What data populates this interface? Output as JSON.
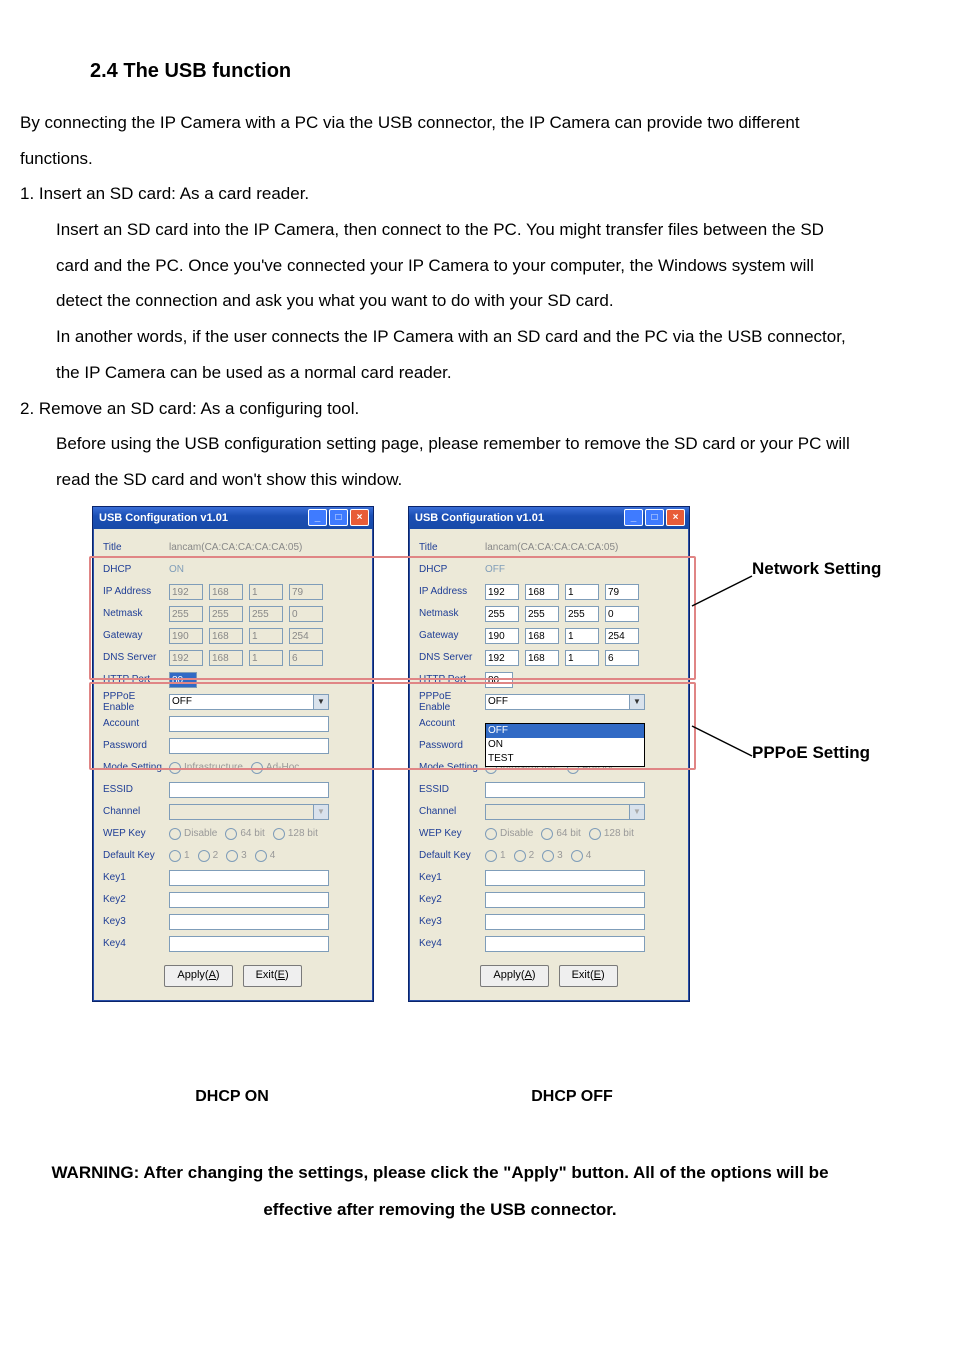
{
  "heading": "2.4 The USB function",
  "intro": "By connecting the IP Camera with a PC via the USB connector, the IP Camera can provide two different functions.",
  "item1": {
    "lead": "1. Insert an SD card: As a card reader.",
    "p1": "Insert an SD card into the IP Camera, then connect to the PC. You might transfer files between the SD card and the PC. Once you've connected your IP Camera to your computer, the Windows system will detect the connection and ask you what you want to do with your SD card.",
    "p2": "In another words, if the user connects the IP Camera with an SD card and the PC via the USB connector, the IP Camera can be used as a normal card reader."
  },
  "item2": {
    "lead": "2. Remove an SD card: As a configuring tool.",
    "p1": "Before using the USB configuration setting page, please remember to remove the SD card or your PC will read the SD card and won't show this window."
  },
  "dialog": {
    "title": "USB Configuration v1.01",
    "title_value": "lancam(CA:CA:CA:CA:CA:05)",
    "labels": {
      "title": "Title",
      "dhcp": "DHCP",
      "ip": "IP Address",
      "netmask": "Netmask",
      "gateway": "Gateway",
      "dns": "DNS Server",
      "http": "HTTP Port",
      "pppoe": "PPPoE Enable",
      "account": "Account",
      "password": "Password",
      "mode": "Mode Setting",
      "essid": "ESSID",
      "channel": "Channel",
      "wep": "WEP Key",
      "defkey": "Default Key",
      "key1": "Key1",
      "key2": "Key2",
      "key3": "Key3",
      "key4": "Key4"
    },
    "radios": {
      "infra": "Infrastructure",
      "adhoc": "Ad-Hoc",
      "disable": "Disable",
      "b64": "64 bit",
      "b128": "128 bit",
      "k1": "1",
      "k2": "2",
      "k3": "3",
      "k4": "4"
    },
    "buttons": {
      "apply": "Apply",
      "apply_key": "A",
      "exit": "Exit",
      "exit_key": "E"
    }
  },
  "left": {
    "dhcp": "ON",
    "ip": [
      "192",
      "168",
      "1",
      "79"
    ],
    "netmask": [
      "255",
      "255",
      "255",
      "0"
    ],
    "gateway": [
      "190",
      "168",
      "1",
      "254"
    ],
    "dns": [
      "192",
      "168",
      "1",
      "6"
    ],
    "http": "80",
    "pppoe": "OFF"
  },
  "right": {
    "dhcp": "OFF",
    "ip": [
      "192",
      "168",
      "1",
      "79"
    ],
    "netmask": [
      "255",
      "255",
      "255",
      "0"
    ],
    "gateway": [
      "190",
      "168",
      "1",
      "254"
    ],
    "dns": [
      "192",
      "168",
      "1",
      "6"
    ],
    "http": "80",
    "pppoe": "OFF",
    "pppoe_options": [
      "OFF",
      "ON",
      "TEST"
    ]
  },
  "captions": {
    "left": "DHCP ON",
    "right": "DHCP OFF"
  },
  "callouts": {
    "network": "Network Setting",
    "pppoe": "PPPoE Setting"
  },
  "warning": "WARNING: After changing the settings, please click the \"Apply\" button. All of the options will be effective after removing the USB connector."
}
